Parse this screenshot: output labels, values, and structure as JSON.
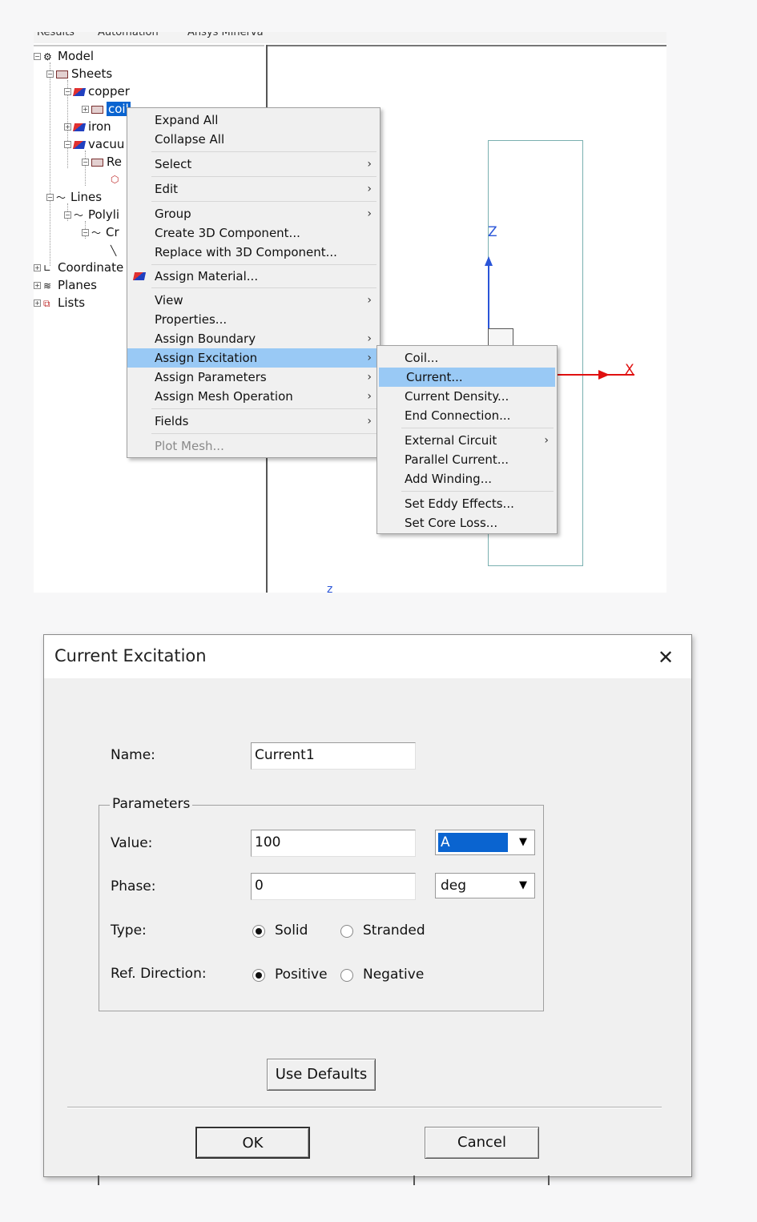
{
  "top_tabs": [
    "Results",
    "Automation",
    "Ansys Minerva"
  ],
  "tree": {
    "model": "Model",
    "sheets": "Sheets",
    "copper": "copper",
    "coil": "coil",
    "iron": "iron",
    "vacuum": "vacuu",
    "region": "Re",
    "lines": "Lines",
    "polyline": "Polyli",
    "create": "Cr",
    "coordinate": "Coordinate",
    "planes": "Planes",
    "lists": "Lists"
  },
  "viewport": {
    "z_label": "Z",
    "x_label": "X",
    "z_bottom": "z"
  },
  "context_menu": {
    "items": [
      {
        "label": "Expand All",
        "submenu": false
      },
      {
        "label": "Collapse All",
        "submenu": false
      },
      {
        "label": "Select",
        "submenu": true
      },
      {
        "label": "Edit",
        "submenu": true
      },
      {
        "label": "Group",
        "submenu": true
      },
      {
        "label": "Create 3D Component...",
        "submenu": false
      },
      {
        "label": "Replace with 3D Component...",
        "submenu": false
      },
      {
        "label": "Assign Material...",
        "submenu": false
      },
      {
        "label": "View",
        "submenu": true
      },
      {
        "label": "Properties...",
        "submenu": false
      },
      {
        "label": "Assign Boundary",
        "submenu": true
      },
      {
        "label": "Assign Excitation",
        "submenu": true
      },
      {
        "label": "Assign Parameters",
        "submenu": true
      },
      {
        "label": "Assign Mesh Operation",
        "submenu": true
      },
      {
        "label": "Fields",
        "submenu": true
      },
      {
        "label": "Plot Mesh...",
        "submenu": false
      }
    ],
    "arrow": "›"
  },
  "submenu": {
    "items": [
      {
        "label": "Coil..."
      },
      {
        "label": "Current..."
      },
      {
        "label": "Current Density..."
      },
      {
        "label": "End Connection..."
      },
      {
        "label": "External Circuit"
      },
      {
        "label": "Parallel Current..."
      },
      {
        "label": "Add Winding..."
      },
      {
        "label": "Set Eddy Effects..."
      },
      {
        "label": "Set Core Loss..."
      }
    ]
  },
  "dialog": {
    "title": "Current Excitation",
    "close_glyph": "✕",
    "name_label": "Name:",
    "name_value": "Current1",
    "group_label": "Parameters",
    "value_label": "Value:",
    "value_value": "100",
    "value_unit": "A",
    "phase_label": "Phase:",
    "phase_value": "0",
    "phase_unit": "deg",
    "dropdown_glyph": "▼",
    "type_label": "Type:",
    "type_solid": "Solid",
    "type_stranded": "Stranded",
    "type_selected": "Solid",
    "refdir_label": "Ref. Direction:",
    "refdir_positive": "Positive",
    "refdir_negative": "Negative",
    "refdir_selected": "Positive",
    "use_defaults": "Use Defaults",
    "ok": "OK",
    "cancel": "Cancel"
  },
  "colors": {
    "menu_highlight": "#99c9f5",
    "selection_blue": "#0a64d0",
    "z_axis": "#2a55d8",
    "x_axis": "#e01010"
  }
}
